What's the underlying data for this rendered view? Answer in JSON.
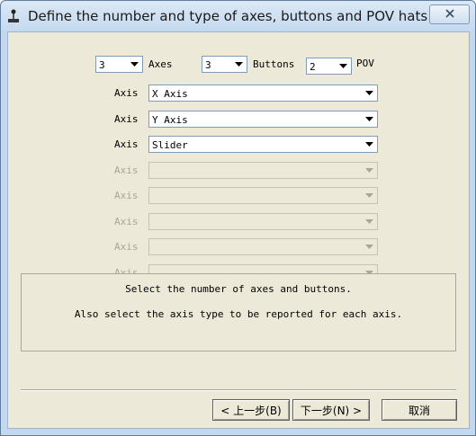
{
  "window": {
    "title": "Define the number and type of axes, buttons and POV hats"
  },
  "counts": {
    "axes": {
      "value": "3",
      "label": "Axes"
    },
    "buttons": {
      "value": "3",
      "label": "Buttons"
    },
    "pov": {
      "value": "2",
      "label": "POV"
    }
  },
  "axes": [
    {
      "label": "Axis",
      "value": "X Axis",
      "enabled": true
    },
    {
      "label": "Axis",
      "value": "Y Axis",
      "enabled": true
    },
    {
      "label": "Axis",
      "value": "Slider",
      "enabled": true
    },
    {
      "label": "Axis",
      "value": "",
      "enabled": false
    },
    {
      "label": "Axis",
      "value": "",
      "enabled": false
    },
    {
      "label": "Axis",
      "value": "",
      "enabled": false
    },
    {
      "label": "Axis",
      "value": "",
      "enabled": false
    },
    {
      "label": "Axis",
      "value": "",
      "enabled": false
    }
  ],
  "info": {
    "line1": "Select the number of axes and buttons.",
    "line2": "Also select the axis type to be reported for each axis."
  },
  "buttons": {
    "back": "< 上一步(B)",
    "next": "下一步(N) >",
    "cancel": "取消"
  },
  "icons": {
    "app": "joystick-icon",
    "close": "close-icon",
    "dropdown": "chevron-down-icon"
  }
}
